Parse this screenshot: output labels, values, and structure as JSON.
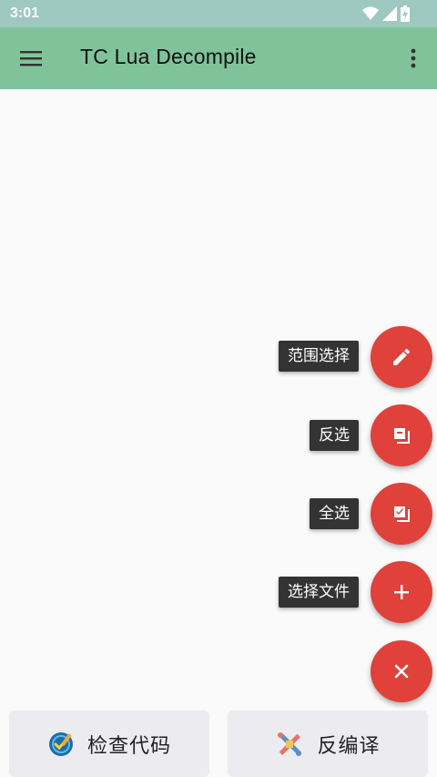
{
  "status_bar": {
    "time": "3:01",
    "icons": [
      "wifi-icon",
      "cellular-signal-icon",
      "battery-charging-icon"
    ]
  },
  "app_bar": {
    "title": "TC Lua Decompile",
    "menu_icon": "hamburger-menu-icon",
    "overflow_icon": "more-vert-icon"
  },
  "fab_menu": {
    "items": [
      {
        "label": "范围选择",
        "icon": "pencil-icon"
      },
      {
        "label": "反选",
        "icon": "invert-selection-icon"
      },
      {
        "label": "全选",
        "icon": "select-all-icon"
      },
      {
        "label": "选择文件",
        "icon": "plus-icon"
      }
    ],
    "main_icon": "close-icon"
  },
  "bottom_actions": {
    "check_code_label": "检查代码",
    "decompile_label": "反编译"
  },
  "colors": {
    "status_bar": "#9ec9c0",
    "app_bar": "#80c39b",
    "fab": "#e0413b",
    "tooltip": "#333333",
    "bottom_button": "#ececf0"
  }
}
